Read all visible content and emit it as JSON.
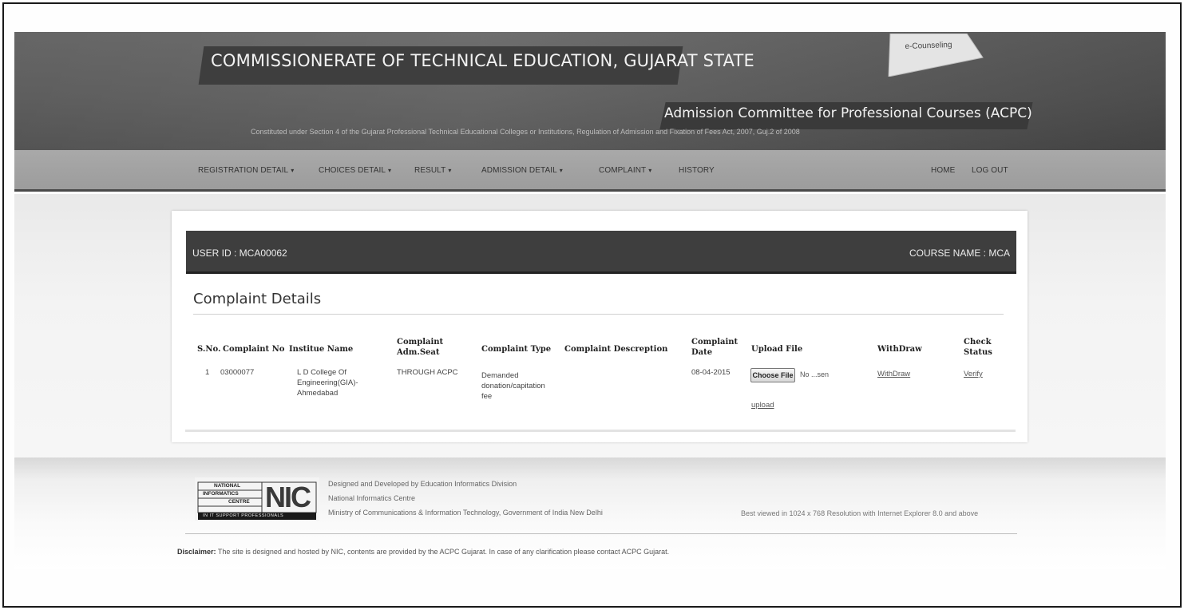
{
  "header": {
    "main_title": "COMMISSIONERATE OF TECHNICAL EDUCATION, GUJARAT STATE",
    "sub_title": "Admission Committee for Professional Courses (ACPC)",
    "constituted_text": "Constituted under Section 4 of the Gujarat Professional Technical Educational Colleges or Institutions, Regulation of Admission and Fixation of Fees Act, 2007, Guj.2 of 2008",
    "badge": "e-Counseling"
  },
  "nav": {
    "items": [
      {
        "label": "REGISTRATION DETAIL",
        "dropdown": true
      },
      {
        "label": "CHOICES DETAIL",
        "dropdown": true
      },
      {
        "label": "RESULT",
        "dropdown": true
      },
      {
        "label": "ADMISSION DETAIL",
        "dropdown": true
      },
      {
        "label": "COMPLAINT",
        "dropdown": true
      },
      {
        "label": "HISTORY",
        "dropdown": false
      }
    ],
    "home": "HOME",
    "logout": "LOG OUT",
    "caret": "▾"
  },
  "user_bar": {
    "user_id": "USER ID : MCA00062",
    "course_name": "COURSE NAME : MCA"
  },
  "section_title": "Complaint Details",
  "table": {
    "headers": {
      "sno": "S.No.",
      "complaint_no": "Complaint No",
      "institute": "Institue Name",
      "adm_seat_1": "Complaint",
      "adm_seat_2": "Adm.Seat",
      "type": "Complaint Type",
      "description": "Complaint Descreption",
      "date_1": "Complaint",
      "date_2": "Date",
      "upload": "Upload File",
      "withdraw": "WithDraw",
      "status_1": "Check",
      "status_2": "Status"
    },
    "row": {
      "sno": "1",
      "complaint_no": "03000077",
      "institute_1": "L D College Of",
      "institute_2": "Engineering(GIA)-",
      "institute_3": "Ahmedabad",
      "adm_seat": "THROUGH ACPC",
      "type_1": "Demanded",
      "type_2": "donation/capitation",
      "type_3": "fee",
      "description": "",
      "date": "08-04-2015",
      "choose_file": "Choose File",
      "file_status": "No ...sen",
      "upload_link": "upload",
      "withdraw_link": "WithDraw",
      "verify_link": "Verify"
    }
  },
  "footer": {
    "nic_logo_top": "NATIONAL",
    "nic_logo_mid": "INFORMATICS",
    "nic_logo_low": "CENTRE",
    "nic_letters": "NIC",
    "nic_tagline": "IN IT SUPPORT PROFESSIONALS",
    "line1": "Designed and Developed by Education Informatics Division",
    "line2": "National Informatics Centre",
    "line3": "Ministry of Communications & Information Technology, Government of India New Delhi",
    "best_viewed": "Best viewed in 1024 x 768 Resolution with Internet Explorer 8.0 and above",
    "disclaimer_label": "Disclaimer:",
    "disclaimer_text": " The site is designed and hosted by NIC, contents are provided by the ACPC Gujarat. In case of any clarification please contact ACPC Gujarat."
  }
}
